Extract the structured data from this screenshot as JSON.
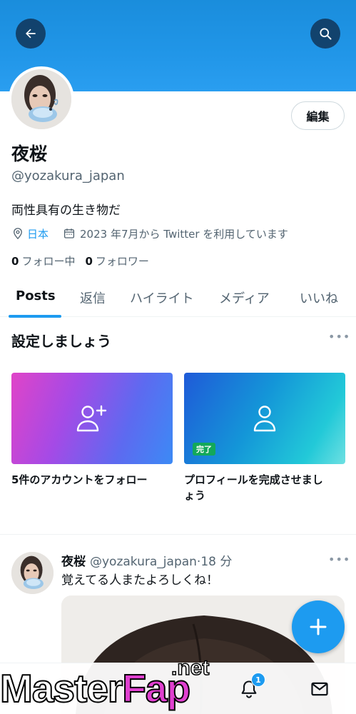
{
  "profile": {
    "name": "夜桜",
    "handle": "@yozakura_japan",
    "bio": "両性具有の生き物だ",
    "location": "日本",
    "joined": "2023 年7月から Twitter を利用しています",
    "following_count": "0",
    "following_label": "フォロー中",
    "followers_count": "0",
    "followers_label": "フォロワー",
    "edit_label": "編集"
  },
  "tabs": [
    {
      "label": "Posts",
      "active": true
    },
    {
      "label": "返信"
    },
    {
      "label": "ハイライト"
    },
    {
      "label": "メディア"
    },
    {
      "label": "いいね"
    }
  ],
  "setup": {
    "title": "設定しましょう",
    "more": "•••",
    "cards": [
      {
        "label": "5件のアカウントをフォロー",
        "icon": "add-user-icon"
      },
      {
        "label_line1": "プロフィールを完成させまし",
        "label_line2": "ょう",
        "badge": "完了",
        "icon": "user-icon"
      }
    ]
  },
  "tweet": {
    "name": "夜桜",
    "handle_time": "@yozakura_japan·18 分",
    "text": "覚えてる人またよろしくね！",
    "more": "•••"
  },
  "nav": {
    "notification_count": "1"
  },
  "watermark": {
    "part1": "Master",
    "part2": "Fap",
    "part3": ".net"
  },
  "colors": {
    "accent": "#1d9bf0",
    "banner": "#2196e8",
    "done_badge": "#13a85a"
  }
}
